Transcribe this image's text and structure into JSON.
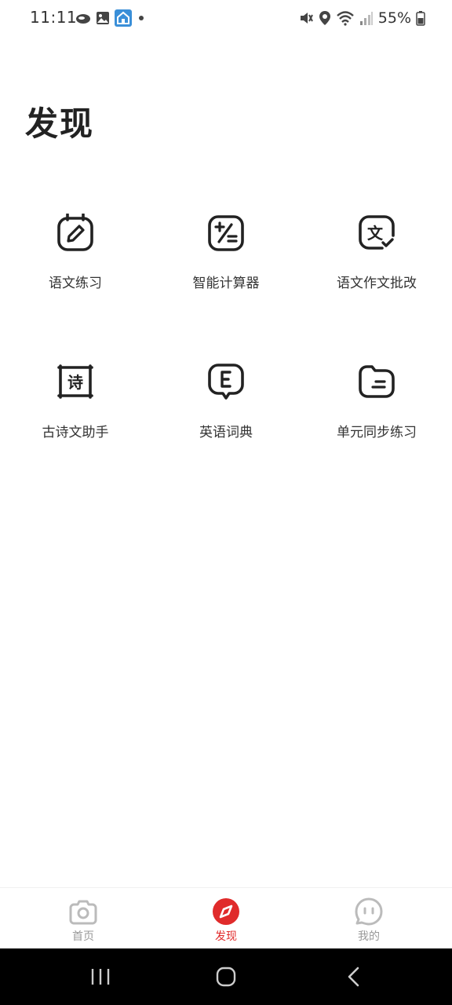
{
  "status_bar": {
    "time": "11:11",
    "battery": "55%",
    "left_icons": [
      "cloud-icon",
      "image-icon",
      "app-icon",
      "dot-icon"
    ],
    "right_icons": [
      "mute-icon",
      "location-icon",
      "wifi-icon",
      "signal-icon",
      "battery-icon"
    ]
  },
  "page": {
    "title": "发现"
  },
  "features": [
    {
      "label": "语文练习",
      "icon": "pencil-calendar-icon"
    },
    {
      "label": "智能计算器",
      "icon": "calculator-icon"
    },
    {
      "label": "语文作文批改",
      "icon": "text-check-icon"
    },
    {
      "label": "古诗文助手",
      "icon": "poem-scroll-icon"
    },
    {
      "label": "英语词典",
      "icon": "english-bubble-icon"
    },
    {
      "label": "单元同步练习",
      "icon": "folder-icon"
    }
  ],
  "bottom_nav": {
    "items": [
      {
        "label": "首页",
        "icon": "camera-icon",
        "active": false
      },
      {
        "label": "发现",
        "icon": "compass-icon",
        "active": true
      },
      {
        "label": "我的",
        "icon": "chat-face-icon",
        "active": false
      }
    ],
    "active_color": "#e02b2b",
    "inactive_color": "#999999"
  },
  "system_nav": [
    "recent-apps-icon",
    "home-icon",
    "back-icon"
  ]
}
